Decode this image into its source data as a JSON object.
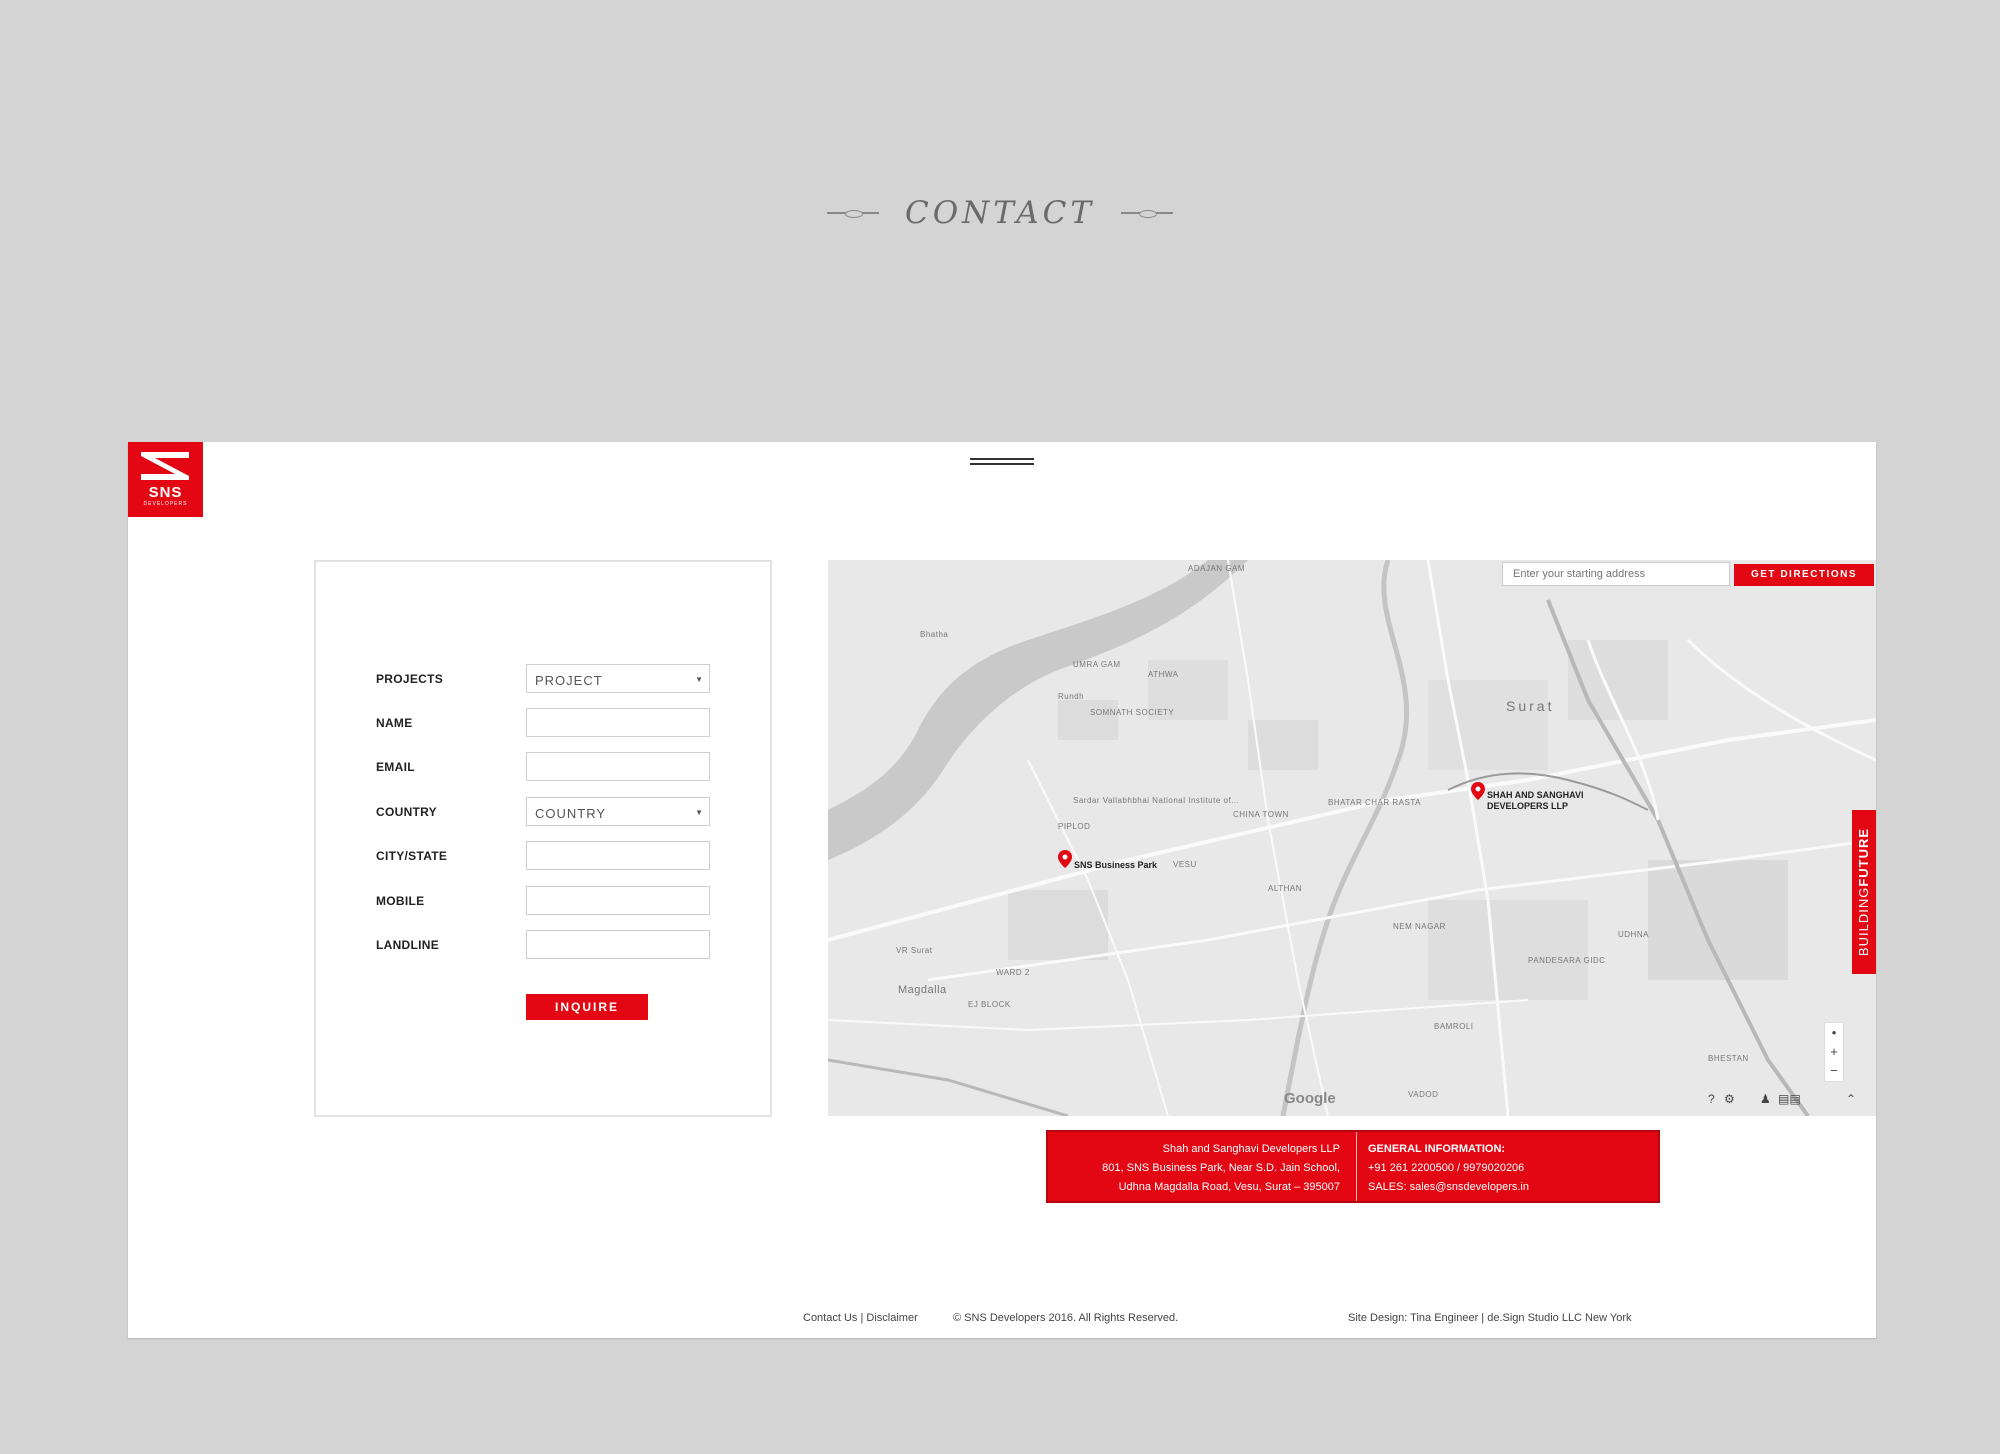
{
  "heading": {
    "title": "CONTACT"
  },
  "brand": {
    "logo_text": "SNS",
    "logo_sub": "DEVELOPERS"
  },
  "form": {
    "fields": [
      {
        "label": "PROJECTS",
        "value": "PROJECT",
        "type": "select"
      },
      {
        "label": "NAME",
        "value": "",
        "type": "text"
      },
      {
        "label": "EMAIL",
        "value": "",
        "type": "text"
      },
      {
        "label": "COUNTRY",
        "value": "COUNTRY",
        "type": "select"
      },
      {
        "label": "CITY/STATE",
        "value": "",
        "type": "text"
      },
      {
        "label": "MOBILE",
        "value": "",
        "type": "text"
      },
      {
        "label": "LANDLINE",
        "value": "",
        "type": "text"
      }
    ],
    "submit_label": "INQUIRE"
  },
  "map": {
    "directions_placeholder": "Enter your starting address",
    "directions_button": "GET DIRECTIONS",
    "markers": [
      {
        "label_line1": "SNS Business Park",
        "label_line2": ""
      },
      {
        "label_line1": "SHAH AND SANGHAVI",
        "label_line2": "DEVELOPERS LLP"
      }
    ],
    "labels": {
      "adajan": "ADAJAN GAM",
      "bhatha": "Bhatha",
      "umra": "UMRA GAM",
      "surat": "Surat",
      "rundh": "Rundh",
      "magdalla": "Magdalla",
      "althan": "ALTHAN",
      "nemnagar": "NEM NAGAR",
      "bhestan": "BHESTAN",
      "udhna": "UDHNA",
      "pandesara": "PANDESARA GIDC",
      "bamroli": "BAMROLI",
      "vadod": "VADOD",
      "vesu": "VESU",
      "piplod": "PIPLOD",
      "chinatown": "CHINA TOWN",
      "athwa": "ATHWA",
      "bhatar": "BHATAR CHAR RASTA",
      "somnath": "SOMNATH SOCIETY",
      "vipsurat": "VR Surat",
      "ejblock": "EJ BLOCK",
      "ward2": "WARD 2",
      "sardar": "Sardar Vallabhbhai National Institute of..."
    },
    "building_tab_light": "BUILDING",
    "building_tab_bold": "FUTURE",
    "zoom_in": "+",
    "zoom_out": "−",
    "google": "Google"
  },
  "info": {
    "company": "Shah and Sanghavi Developers LLP",
    "address1": "801, SNS Business Park, Near S.D. Jain School,",
    "address2": "Udhna Magdalla Road, Vesu, Surat – 395007",
    "general_heading": "GENERAL INFORMATION:",
    "phone": "+91 261 2200500 / 9979020206",
    "sales": "SALES: sales@snsdevelopers.in"
  },
  "footer": {
    "contact_link": "Contact Us",
    "separator": "|",
    "disclaimer_link": "Disclaimer",
    "copyright": "© SNS Developers 2016. All Rights Reserved.",
    "credit": "Site Design: Tina Engineer | de.Sign Studio LLC New York"
  },
  "colors": {
    "brand_red": "#e30613",
    "page_bg": "#d4d4d4",
    "map_bg": "#e6e6e6"
  }
}
